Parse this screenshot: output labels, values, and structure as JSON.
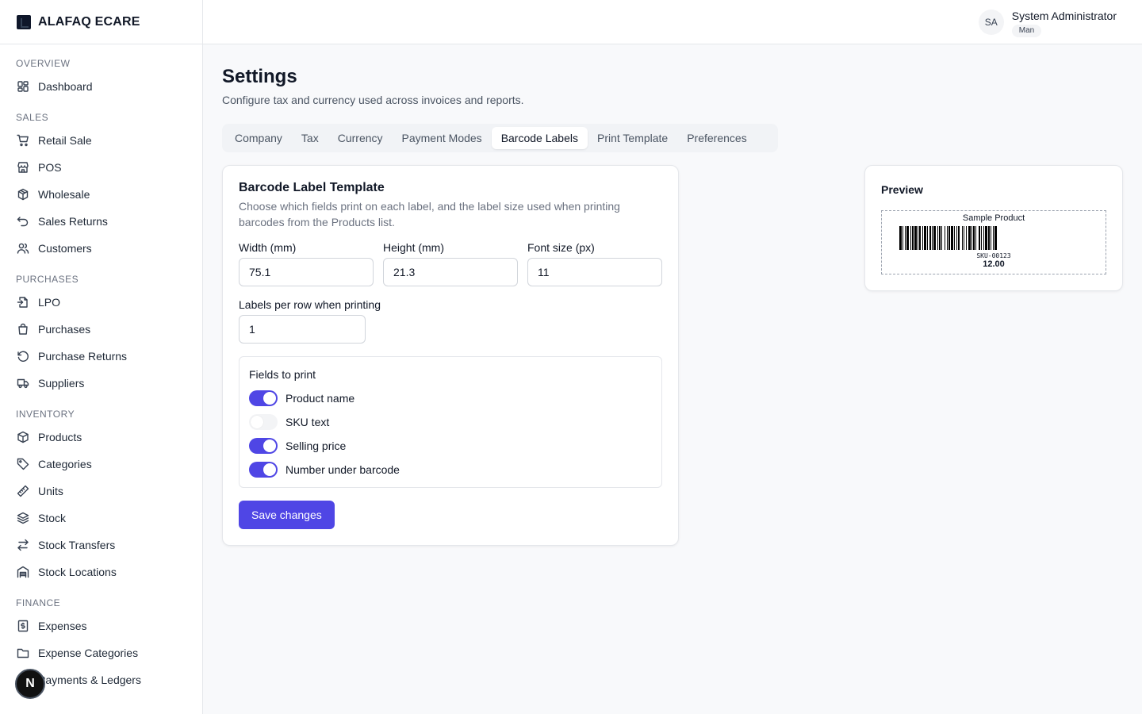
{
  "brand": {
    "name": "ALAFAQ ECARE"
  },
  "sidebar": {
    "sections": [
      {
        "title": "OVERVIEW",
        "items": [
          {
            "label": "Dashboard",
            "icon": "dashboard-icon"
          }
        ]
      },
      {
        "title": "SALES",
        "items": [
          {
            "label": "Retail Sale",
            "icon": "cart-icon"
          },
          {
            "label": "POS",
            "icon": "store-icon"
          },
          {
            "label": "Wholesale",
            "icon": "boxes-icon"
          },
          {
            "label": "Sales Returns",
            "icon": "undo-icon"
          },
          {
            "label": "Customers",
            "icon": "users-icon"
          }
        ]
      },
      {
        "title": "PURCHASES",
        "items": [
          {
            "label": "LPO",
            "icon": "file-import-icon"
          },
          {
            "label": "Purchases",
            "icon": "bag-icon"
          },
          {
            "label": "Purchase Returns",
            "icon": "rotate-ccw-icon"
          },
          {
            "label": "Suppliers",
            "icon": "truck-icon"
          }
        ]
      },
      {
        "title": "INVENTORY",
        "items": [
          {
            "label": "Products",
            "icon": "package-icon"
          },
          {
            "label": "Categories",
            "icon": "tag-icon"
          },
          {
            "label": "Units",
            "icon": "ruler-icon"
          },
          {
            "label": "Stock",
            "icon": "layers-icon"
          },
          {
            "label": "Stock Transfers",
            "icon": "transfer-icon"
          },
          {
            "label": "Stock Locations",
            "icon": "warehouse-icon"
          }
        ]
      },
      {
        "title": "FINANCE",
        "items": [
          {
            "label": "Expenses",
            "icon": "receipt-icon"
          },
          {
            "label": "Expense Categories",
            "icon": "folder-icon"
          },
          {
            "label": "Payments & Ledgers",
            "icon": "wallet-icon"
          }
        ]
      }
    ]
  },
  "user": {
    "initials": "SA",
    "name": "System Administrator",
    "role": "Man"
  },
  "page": {
    "title": "Settings",
    "subtitle": "Configure tax and currency used across invoices and reports."
  },
  "tabs": [
    {
      "label": "Company",
      "active": false
    },
    {
      "label": "Tax",
      "active": false
    },
    {
      "label": "Currency",
      "active": false
    },
    {
      "label": "Payment Modes",
      "active": false
    },
    {
      "label": "Barcode Labels",
      "active": true
    },
    {
      "label": "Print Template",
      "active": false
    },
    {
      "label": "Preferences",
      "active": false
    }
  ],
  "form": {
    "title": "Barcode Label Template",
    "description": "Choose which fields print on each label, and the label size used when printing barcodes from the Products list.",
    "width_label": "Width (mm)",
    "width_value": "75.1",
    "height_label": "Height (mm)",
    "height_value": "21.3",
    "font_label": "Font size (px)",
    "font_value": "11",
    "per_row_label": "Labels per row when printing",
    "per_row_value": "1",
    "fields_title": "Fields to print",
    "toggles": [
      {
        "label": "Product name",
        "on": true
      },
      {
        "label": "SKU text",
        "on": false
      },
      {
        "label": "Selling price",
        "on": true
      },
      {
        "label": "Number under barcode",
        "on": true
      }
    ],
    "save_label": "Save changes"
  },
  "preview": {
    "title": "Preview",
    "product_name": "Sample Product",
    "sku": "SKU-00123",
    "price": "12.00"
  },
  "colors": {
    "accent": "#4f46e5",
    "toggle_off": "#f3f4f6",
    "border": "#e5e7eb"
  },
  "floating_badge": {
    "letter": "N"
  }
}
